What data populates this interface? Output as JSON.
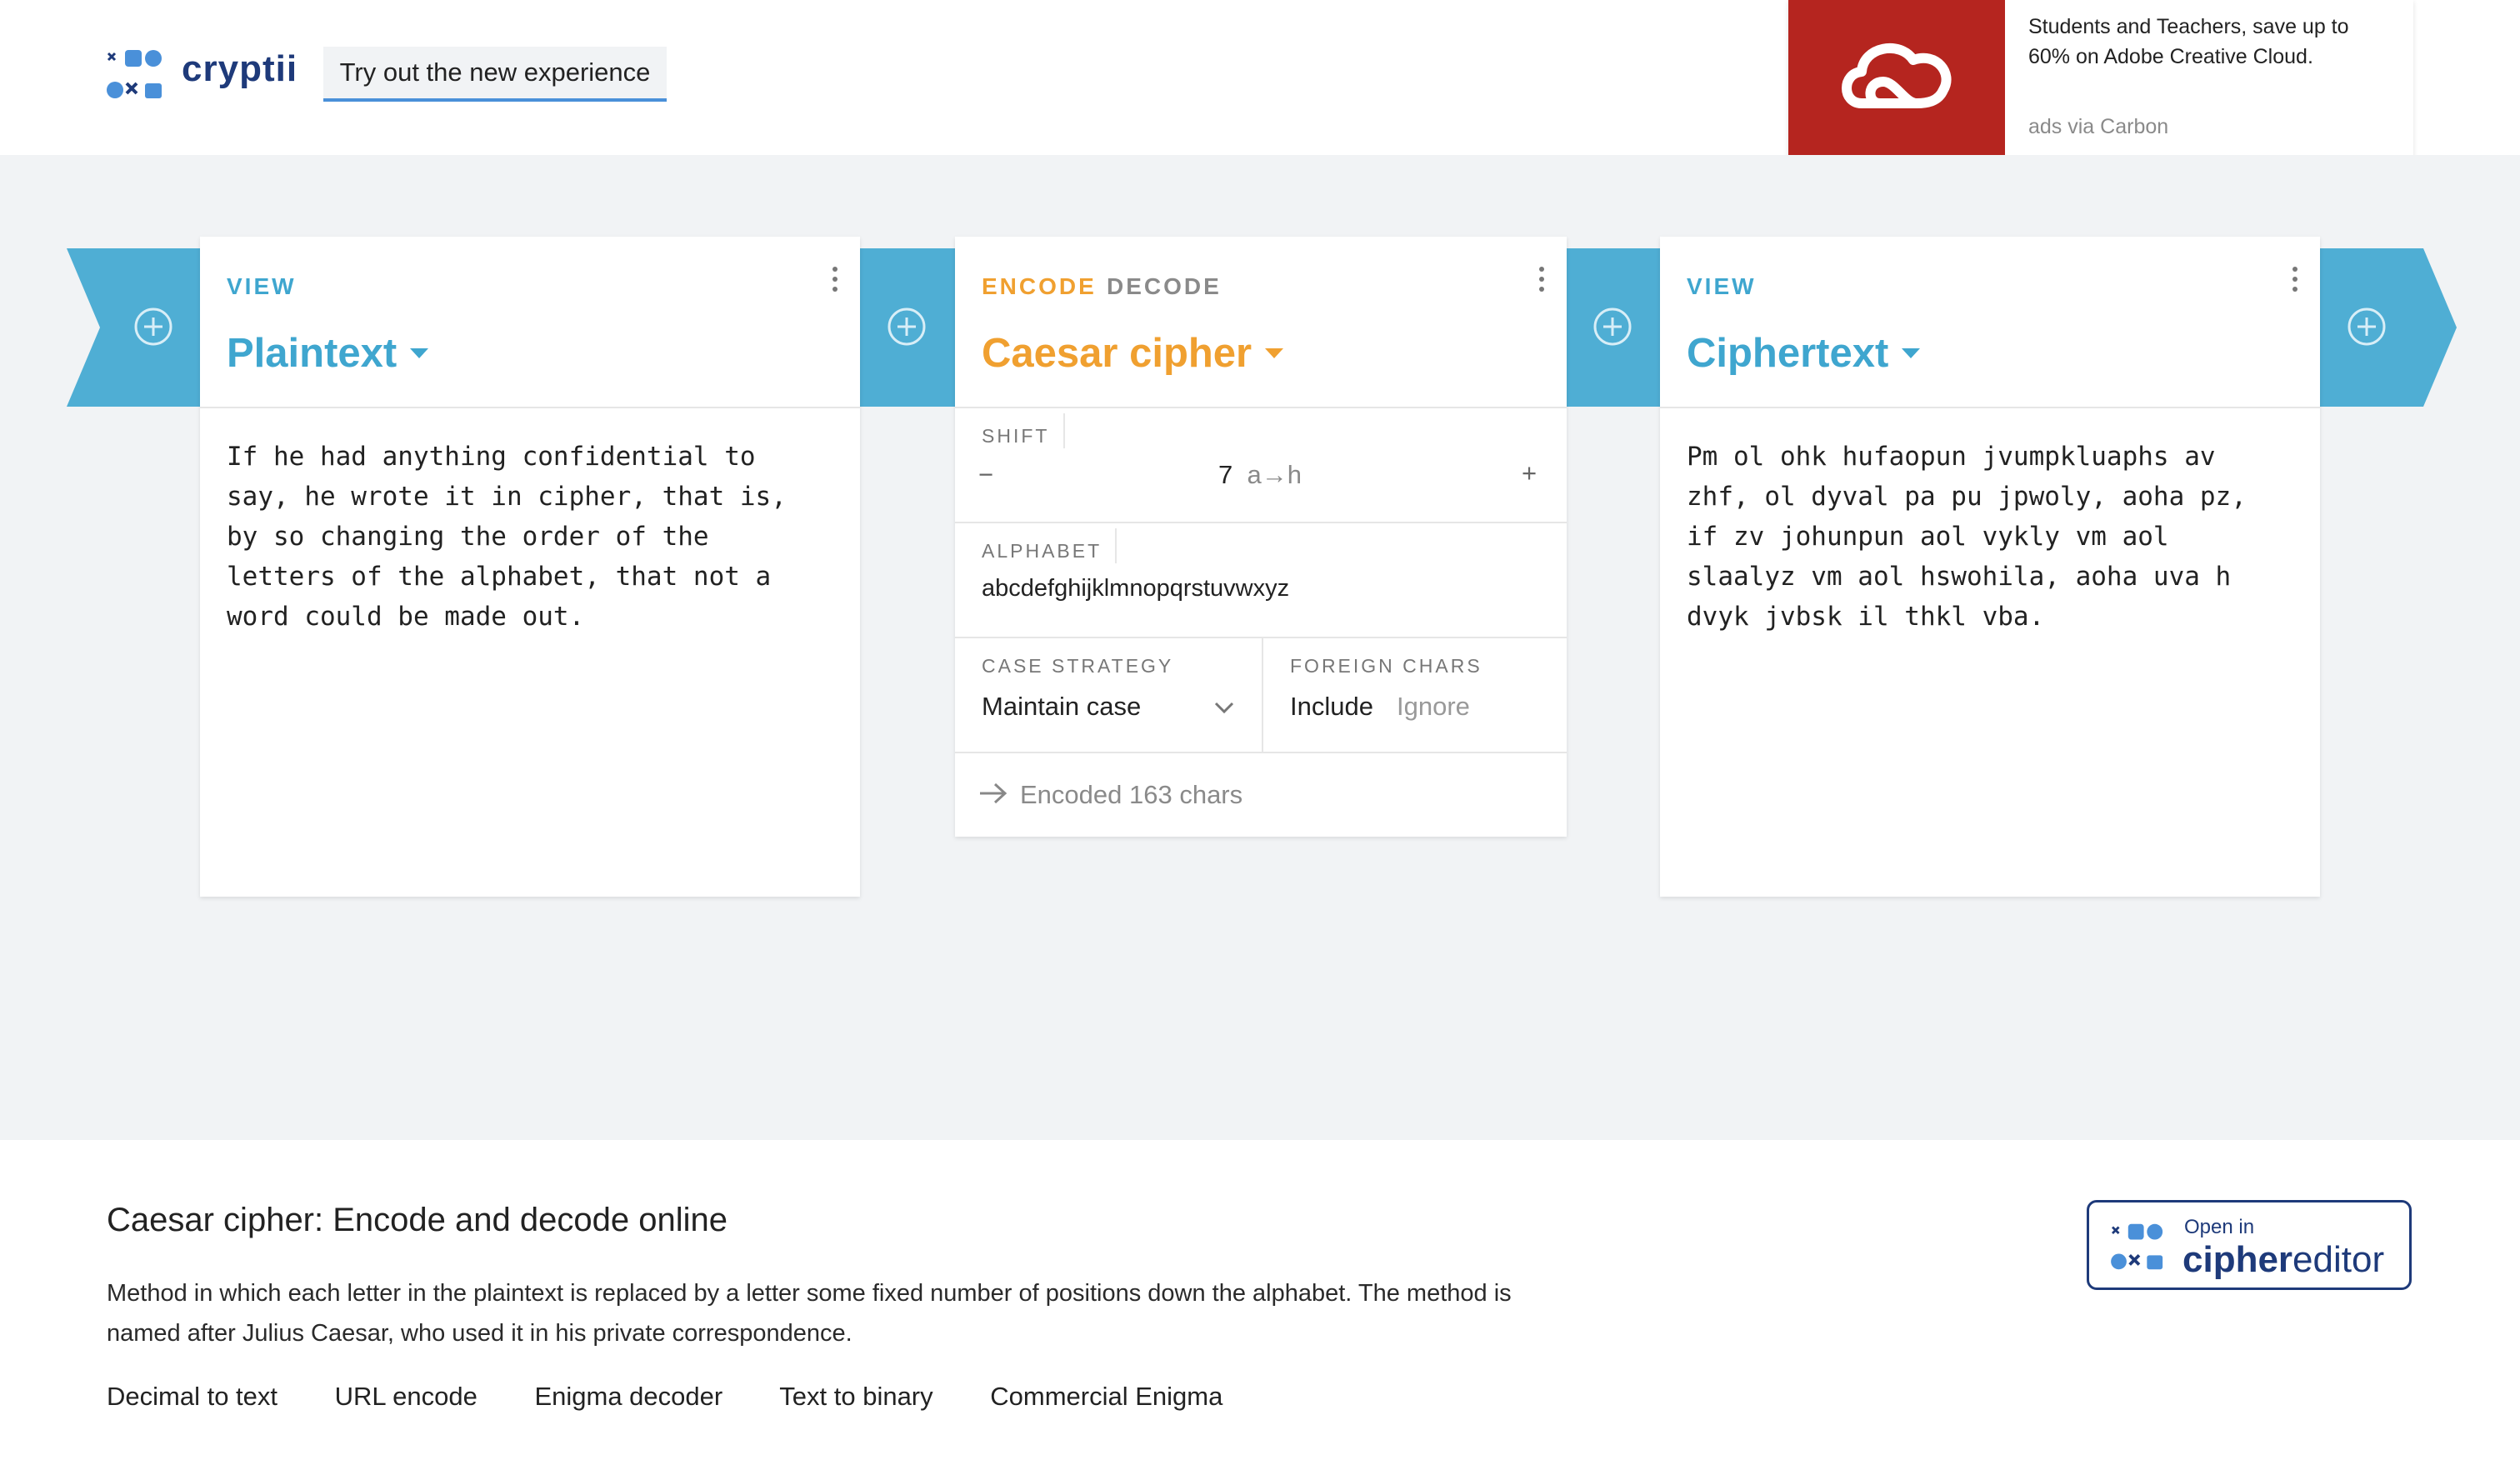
{
  "colors": {
    "accent_blue": "#3fa6cf",
    "ribbon_blue": "#4faed4",
    "accent_orange": "#f0a030",
    "brand_navy": "#1e3a7a",
    "ad_red": "#b5251f"
  },
  "header": {
    "brand": "cryptii",
    "try_button": "Try out the new experience"
  },
  "ad": {
    "text": "Students and Teachers, save up to 60% on Adobe Creative Cloud.",
    "via": "ads via Carbon",
    "icon": "creative-cloud-icon"
  },
  "pipeline": {
    "left_view": {
      "mode": "VIEW",
      "title": "Plaintext",
      "content": "If he had anything confidential to\nsay, he wrote it in cipher, that is,\nby so changing the order of the\nletters of the alphabet, that not a\nword could be made out."
    },
    "encoder": {
      "mode_encode": "ENCODE",
      "mode_decode": "DECODE",
      "title": "Caesar cipher",
      "shift_label": "SHIFT",
      "shift_minus": "−",
      "shift_value": "7",
      "shift_mapping": "a→h",
      "shift_plus": "+",
      "alphabet_label": "ALPHABET",
      "alphabet_value": "abcdefghijklmnopqrstuvwxyz",
      "case_label": "CASE STRATEGY",
      "case_value": "Maintain case",
      "foreign_label": "FOREIGN CHARS",
      "foreign_include": "Include",
      "foreign_ignore": "Ignore",
      "status": "Encoded 163 chars"
    },
    "right_view": {
      "mode": "VIEW",
      "title": "Ciphertext",
      "content": "Pm ol ohk hufaopun jvumpkluaphs av\nzhf, ol dyval pa pu jpwoly, aoha pz,\nif zv johunpun aol vykly vm aol\nslaalyz vm aol hswohila, aoha uva h\ndvyk jvbsk il thkl vba."
    }
  },
  "footer": {
    "title": "Caesar cipher: Encode and decode online",
    "description": "Method in which each letter in the plaintext is replaced by a letter some fixed number of positions down the alphabet. The method is named after Julius Caesar, who used it in his private correspondence.",
    "links": [
      "Decimal to text",
      "URL encode",
      "Enigma decoder",
      "Text to binary",
      "Commercial Enigma"
    ],
    "editor_open": "Open in",
    "editor_name_bold": "cipher",
    "editor_name_rest": "editor"
  }
}
